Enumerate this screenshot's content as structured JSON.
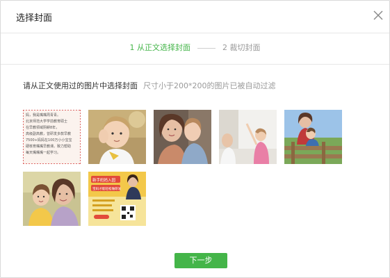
{
  "dialog": {
    "title": "选择封面"
  },
  "steps": [
    {
      "label": "1 从正文选择封面",
      "state": "active"
    },
    {
      "label": "2 裁切封面",
      "state": "inactive"
    }
  ],
  "instruction": {
    "main": "请从正文使用过的图片中选择封面",
    "hint": "尺寸小于200*200的图片已被自动过滤"
  },
  "thumbnails": [
    {
      "kind": "handwritten-note",
      "lines": [
        "妈，我是嘴嘴周青青。",
        "北京师范大学学前教育硕士",
        "在早教领域阴耕8年，",
        "高级副高教，曾研发多款早教",
        "7500+妈妈在100万小小宝宝",
        "硬核育嘴嘴早教课。致力帮助",
        "每天嘴嘴嘴一起学习。"
      ]
    },
    {
      "kind": "photo-child-thinking"
    },
    {
      "kind": "photo-mother-child-hug"
    },
    {
      "kind": "photo-child-reaching"
    },
    {
      "kind": "photo-mother-child-fence"
    },
    {
      "kind": "photo-mother-child-smile"
    },
    {
      "kind": "poster",
      "lines": [
        "新手妈妈入园",
        "宝妈才能轻松做研发"
      ]
    }
  ],
  "colors": {
    "accent": "#44b549",
    "text": "#333333",
    "muted": "#9a9a9a"
  },
  "footer": {
    "next_label": "下一步"
  },
  "icons": {
    "close": "close-icon"
  }
}
